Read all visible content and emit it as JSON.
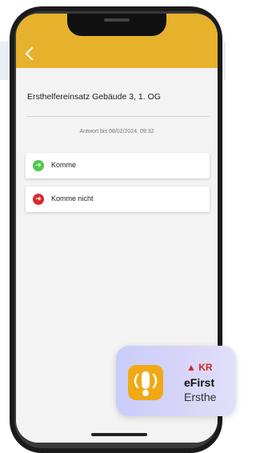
{
  "header": {
    "back_icon": "chevron-left-icon",
    "color": "#e6b22c"
  },
  "request": {
    "title": "Ersthelfereinsatz Gebäude 3, 1. OG",
    "deadline": "Antwort bis 08/02/2024, 09:32"
  },
  "options": [
    {
      "label": "Komme",
      "icon": "arrow-right-icon",
      "color": "#4ec94a"
    },
    {
      "label": "Komme nicht",
      "icon": "arrow-right-icon",
      "color": "#d92b2b"
    }
  ],
  "notification": {
    "severity": "▲ KR",
    "app": "eFirst",
    "text": "Ersthe",
    "icon": "alert-broadcast-icon",
    "icon_color": "#f0a914",
    "severity_color": "#cf2a22"
  }
}
